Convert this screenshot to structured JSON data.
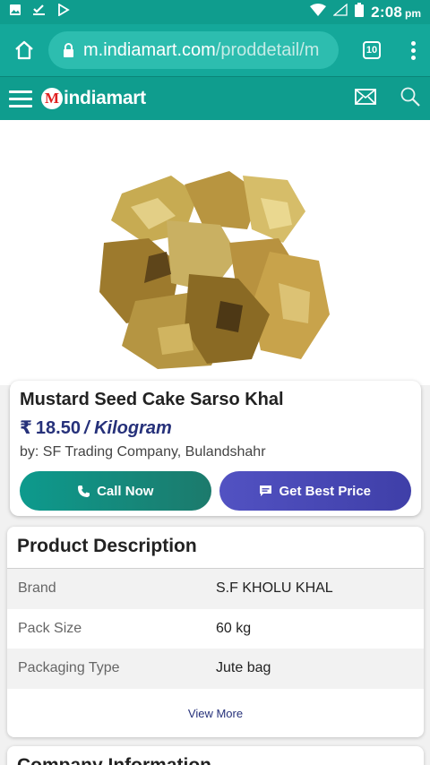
{
  "status_bar": {
    "time": "2:08",
    "ampm": "pm"
  },
  "browser": {
    "url_host": "m.indiamart.com",
    "url_path": "/proddetail/m",
    "tab_count": "10"
  },
  "site": {
    "logo_text": "indiamart",
    "logo_mark": "M"
  },
  "product": {
    "name": "Mustard Seed Cake Sarso Khal",
    "currency": "₹",
    "price": "18.50",
    "unit": "/ Kilogram",
    "seller": "by: SF Trading Company, Bulandshahr",
    "call_label": "Call Now",
    "best_price_label": "Get Best Price"
  },
  "description": {
    "title": "Product Description",
    "specs": [
      {
        "key": "Brand",
        "value": "S.F KHOLU KHAL"
      },
      {
        "key": "Pack Size",
        "value": "60 kg"
      },
      {
        "key": "Packaging Type",
        "value": "Jute bag"
      }
    ],
    "view_more": "View More"
  },
  "company": {
    "title": "Company Information"
  },
  "colors": {
    "teal": "#0f9d8e",
    "navy": "#26317a",
    "purple": "#4a4ab8"
  }
}
